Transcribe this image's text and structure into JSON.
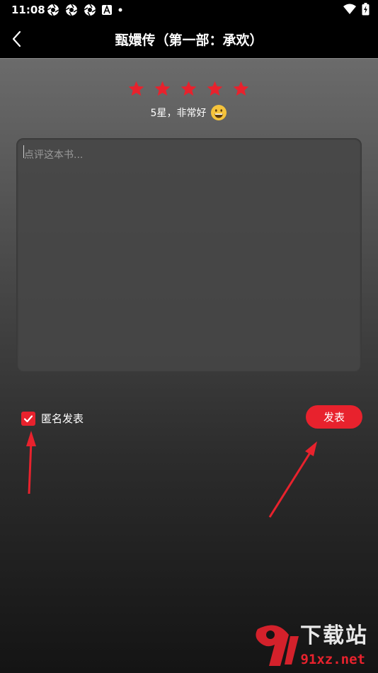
{
  "status_bar": {
    "time": "11:08",
    "left_icons": [
      "aperture-icon",
      "aperture-icon",
      "aperture-icon",
      "font-a-icon",
      "dot-icon"
    ],
    "right_icons": [
      "wifi-icon",
      "battery-charging-icon"
    ]
  },
  "app_bar": {
    "title": "甄嬛传（第一部：承欢）",
    "back_icon": "chevron-left-icon"
  },
  "rating": {
    "stars": 5,
    "max": 5,
    "text": "5星，非常好",
    "emoji": "grinning-face-icon",
    "star_color": "#e8222d"
  },
  "review": {
    "placeholder": "点评这本书...",
    "value": ""
  },
  "anonymous": {
    "label": "匿名发表",
    "checked": true
  },
  "submit": {
    "label": "发表"
  },
  "watermark": {
    "text_top": "下载站",
    "text_bottom": "91xz.net"
  },
  "colors": {
    "accent": "#e8222d",
    "background_top": "#6b6b6b",
    "background_bottom": "#141414"
  }
}
